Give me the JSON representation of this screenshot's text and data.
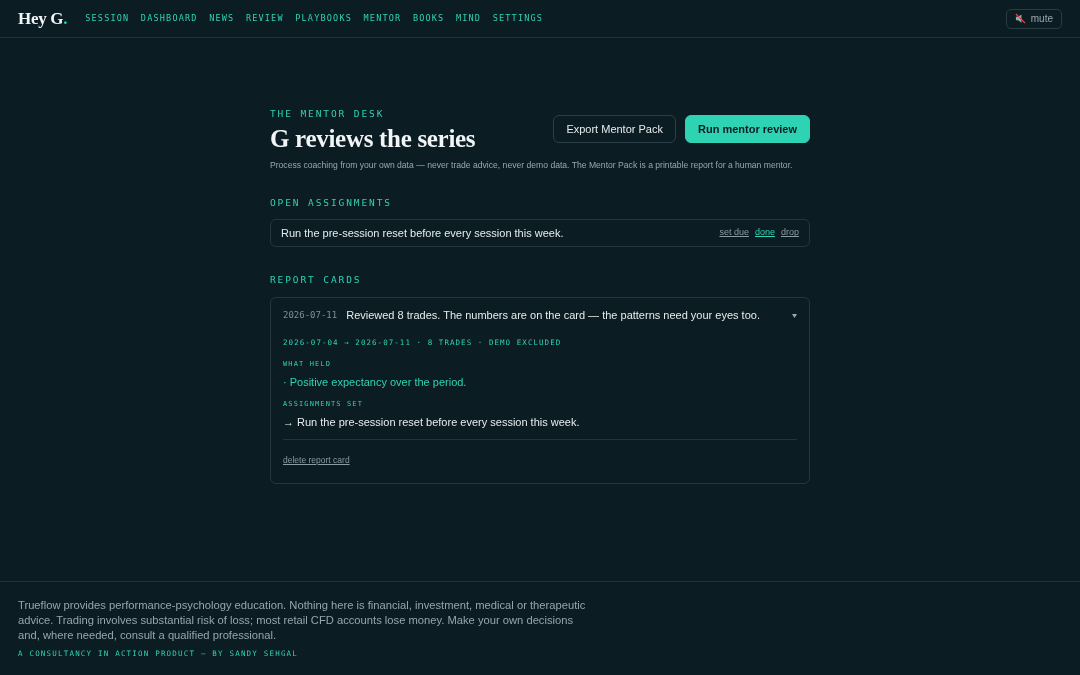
{
  "header": {
    "logo": {
      "text": "Hey G",
      "accent": "."
    },
    "nav": [
      {
        "label": "SESSION"
      },
      {
        "label": "DASHBOARD"
      },
      {
        "label": "NEWS"
      },
      {
        "label": "REVIEW"
      },
      {
        "label": "PLAYBOOKS"
      },
      {
        "label": "MENTOR"
      },
      {
        "label": "BOOKS"
      },
      {
        "label": "MIND"
      },
      {
        "label": "SETTINGS"
      }
    ],
    "mute_button": {
      "label": "mute",
      "muted": true
    }
  },
  "page": {
    "eyebrow": "THE MENTOR DESK",
    "title": "G reviews the series",
    "subtitle": "Process coaching from your own data — never trade advice, never demo data. The Mentor Pack is a printable report for a human mentor.",
    "actions": [
      {
        "label": "Export Mentor Pack",
        "kind": "secondary"
      },
      {
        "label": "Run mentor review",
        "kind": "primary"
      }
    ]
  },
  "open_assignments": {
    "heading": "OPEN ASSIGNMENTS",
    "items": [
      {
        "text": "Run the pre-session reset before every session this week.",
        "actions": [
          {
            "label": "set due",
            "kind": "plain"
          },
          {
            "label": "done",
            "kind": "accent"
          },
          {
            "label": "drop",
            "kind": "plain"
          }
        ]
      }
    ]
  },
  "report_cards": {
    "heading": "REPORT CARDS",
    "cards": [
      {
        "date": "2026-07-11",
        "summary": "Reviewed 8 trades. The numbers are on the card — the patterns need your eyes too.",
        "expanded": true,
        "meta": "2026-07-04 → 2026-07-11 · 8 TRADES · DEMO EXCLUDED",
        "sections": [
          {
            "heading": "WHAT HELD",
            "kind": "held",
            "items": [
              "· Positive expectancy over the period."
            ]
          },
          {
            "heading": "ASSIGNMENTS SET",
            "kind": "assignment",
            "items": [
              "→ Run the pre-session reset before every session this week."
            ]
          }
        ],
        "delete_link": "delete report card"
      }
    ]
  },
  "footer": {
    "disclaimer": "Trueflow provides performance-psychology education. Nothing here is financial, investment, medical or therapeutic advice. Trading involves substantial risk of loss; most retail CFD accounts lose money. Make your own decisions and, where needed, consult a qualified professional.",
    "credit": "A CONSULTANCY IN ACTION PRODUCT — BY SANDY SEHGAL"
  }
}
